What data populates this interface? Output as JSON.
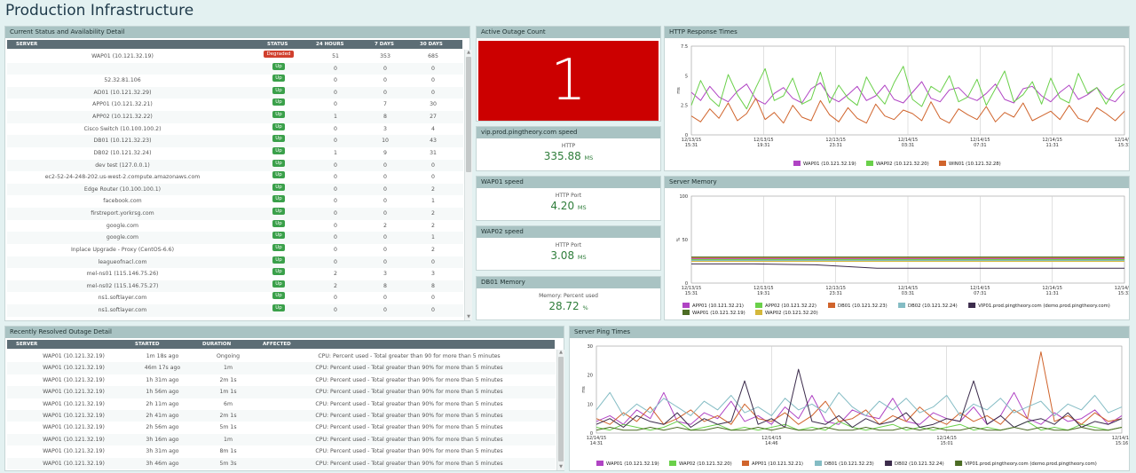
{
  "page_title": "Production Infrastructure",
  "colors": {
    "purple": "#b044c4",
    "green": "#6ad04a",
    "orange": "#d0642c",
    "teal": "#84bcc4",
    "dark": "#3c2c4c",
    "olive": "#4c6c24",
    "yellow": "#d4b83c",
    "red": "#cc0000",
    "up": "#3aa04a",
    "degraded": "#d0402e"
  },
  "status": {
    "header": "Current Status and Availability Detail",
    "columns": [
      "SERVER",
      "STATUS",
      "24 HOURS",
      "7 DAYS",
      "30 DAYS"
    ],
    "rows": [
      {
        "server": "WAP01 (10.121.32.19)",
        "status": "Degraded",
        "h24": "51",
        "d7": "353",
        "d30": "685"
      },
      {
        "server": "",
        "status": "Up",
        "h24": "0",
        "d7": "0",
        "d30": "0"
      },
      {
        "server": "52.32.81.106",
        "status": "Up",
        "h24": "0",
        "d7": "0",
        "d30": "0"
      },
      {
        "server": "AD01 (10.121.32.29)",
        "status": "Up",
        "h24": "0",
        "d7": "0",
        "d30": "0"
      },
      {
        "server": "APP01 (10.121.32.21)",
        "status": "Up",
        "h24": "0",
        "d7": "7",
        "d30": "30"
      },
      {
        "server": "APP02 (10.121.32.22)",
        "status": "Up",
        "h24": "1",
        "d7": "8",
        "d30": "27"
      },
      {
        "server": "Cisco Switch (10.100.100.2)",
        "status": "Up",
        "h24": "0",
        "d7": "3",
        "d30": "4"
      },
      {
        "server": "DB01 (10.121.32.23)",
        "status": "Up",
        "h24": "0",
        "d7": "10",
        "d30": "43"
      },
      {
        "server": "DB02 (10.121.32.24)",
        "status": "Up",
        "h24": "1",
        "d7": "9",
        "d30": "31"
      },
      {
        "server": "dev test (127.0.0.1)",
        "status": "Up",
        "h24": "0",
        "d7": "0",
        "d30": "0"
      },
      {
        "server": "ec2-52-24-248-202.us-west-2.compute.amazonaws.com",
        "status": "Up",
        "h24": "0",
        "d7": "0",
        "d30": "0"
      },
      {
        "server": "Edge Router (10.100.100.1)",
        "status": "Up",
        "h24": "0",
        "d7": "0",
        "d30": "2"
      },
      {
        "server": "facebook.com",
        "status": "Up",
        "h24": "0",
        "d7": "0",
        "d30": "1"
      },
      {
        "server": "firstreport.yorkrsg.com",
        "status": "Up",
        "h24": "0",
        "d7": "0",
        "d30": "2"
      },
      {
        "server": "google.com",
        "status": "Up",
        "h24": "0",
        "d7": "2",
        "d30": "2"
      },
      {
        "server": "google.com",
        "status": "Up",
        "h24": "0",
        "d7": "0",
        "d30": "1"
      },
      {
        "server": "Inplace Upgrade - Proxy (CentOS-6.6)",
        "status": "Up",
        "h24": "0",
        "d7": "0",
        "d30": "2"
      },
      {
        "server": "leagueofnacl.com",
        "status": "Up",
        "h24": "0",
        "d7": "0",
        "d30": "0"
      },
      {
        "server": "mel-ns01 (115.146.75.26)",
        "status": "Up",
        "h24": "2",
        "d7": "3",
        "d30": "3"
      },
      {
        "server": "mel-ns02 (115.146.75.27)",
        "status": "Up",
        "h24": "2",
        "d7": "8",
        "d30": "8"
      },
      {
        "server": "ns1.softlayer.com",
        "status": "Up",
        "h24": "0",
        "d7": "0",
        "d30": "0"
      },
      {
        "server": "ns1.softlayer.com",
        "status": "Up",
        "h24": "0",
        "d7": "0",
        "d30": "0"
      }
    ]
  },
  "resolved": {
    "header": "Recently Resolved Outage Detail",
    "columns": [
      "SERVER",
      "STARTED",
      "DURATION",
      "AFFECTED"
    ],
    "rows": [
      {
        "server": "WAP01 (10.121.32.19)",
        "started": "1m 18s ago",
        "duration": "Ongoing",
        "affected": "CPU: Percent used - Total greater than 90 for more than 5 minutes"
      },
      {
        "server": "WAP01 (10.121.32.19)",
        "started": "46m 17s ago",
        "duration": "1m",
        "affected": "CPU: Percent used - Total greater than 90% for more than 5 minutes"
      },
      {
        "server": "WAP01 (10.121.32.19)",
        "started": "1h 31m ago",
        "duration": "2m 1s",
        "affected": "CPU: Percent used - Total greater than 90% for more than 5 minutes"
      },
      {
        "server": "WAP01 (10.121.32.19)",
        "started": "1h 56m ago",
        "duration": "1m 1s",
        "affected": "CPU: Percent used - Total greater than 90% for more than 5 minutes"
      },
      {
        "server": "WAP01 (10.121.32.19)",
        "started": "2h 11m ago",
        "duration": "6m",
        "affected": "CPU: Percent used - Total greater than 90% for more than 5 minutes"
      },
      {
        "server": "WAP01 (10.121.32.19)",
        "started": "2h 41m ago",
        "duration": "2m 1s",
        "affected": "CPU: Percent used - Total greater than 90% for more than 5 minutes"
      },
      {
        "server": "WAP01 (10.121.32.19)",
        "started": "2h 56m ago",
        "duration": "5m 1s",
        "affected": "CPU: Percent used - Total greater than 90% for more than 5 minutes"
      },
      {
        "server": "WAP01 (10.121.32.19)",
        "started": "3h 16m ago",
        "duration": "1m",
        "affected": "CPU: Percent used - Total greater than 90% for more than 5 minutes"
      },
      {
        "server": "WAP01 (10.121.32.19)",
        "started": "3h 31m ago",
        "duration": "8m 1s",
        "affected": "CPU: Percent used - Total greater than 90% for more than 5 minutes"
      },
      {
        "server": "WAP01 (10.121.32.19)",
        "started": "3h 46m ago",
        "duration": "5m 3s",
        "affected": "CPU: Percent used - Total greater than 90% for more than 5 minutes"
      }
    ]
  },
  "outage": {
    "header": "Active Outage Count",
    "value": "1"
  },
  "metrics": [
    {
      "header": "vip.prod.pingtheory.com speed",
      "label": "HTTP",
      "value": "335.88",
      "unit": "MS"
    },
    {
      "header": "WAP01 speed",
      "label": "HTTP Port",
      "value": "4.20",
      "unit": "MS"
    },
    {
      "header": "WAP02 speed",
      "label": "HTTP Port",
      "value": "3.08",
      "unit": "MS"
    },
    {
      "header": "DB01 Memory",
      "label": "Memory: Percent used",
      "value": "28.72",
      "unit": "%"
    }
  ],
  "chart_data": [
    {
      "type": "line",
      "title": "HTTP Response Times",
      "ylabel": "ms",
      "ylim": [
        0,
        7.5
      ],
      "y_ticks": [
        "7.5",
        "5",
        "2.5",
        "0"
      ],
      "x_ticks": [
        "12/13/15\n15:31",
        "12/13/15\n19:31",
        "12/13/15\n23:31",
        "12/14/15\n03:31",
        "12/14/15\n07:31",
        "12/14/15\n11:31",
        "12/14/15\n15:31"
      ],
      "series": [
        {
          "name": "WAP01 (10.121.32.19)",
          "color": "#b044c4",
          "values": [
            3.6,
            2.9,
            4.1,
            3.2,
            2.8,
            3.7,
            4.3,
            3.0,
            2.6,
            3.5,
            4.0,
            3.1,
            2.7,
            3.9,
            4.4,
            3.2,
            2.8,
            3.4,
            4.1,
            2.9,
            3.3,
            4.2,
            3.0,
            2.7,
            3.6,
            4.5,
            3.1,
            2.8,
            3.8,
            4.0,
            3.2,
            2.9,
            3.5,
            4.3,
            3.0,
            2.7,
            3.9,
            4.1,
            3.3,
            2.8,
            3.6,
            4.2,
            3.0,
            3.4,
            4.0,
            3.1,
            2.8,
            3.7
          ]
        },
        {
          "name": "WAP02 (10.121.32.20)",
          "color": "#6ad04a",
          "values": [
            2.5,
            4.6,
            3.1,
            2.4,
            5.1,
            3.4,
            2.2,
            4.0,
            5.6,
            2.9,
            3.3,
            4.8,
            2.6,
            3.0,
            5.3,
            2.7,
            4.2,
            3.1,
            2.5,
            4.9,
            3.5,
            2.6,
            4.4,
            5.8,
            3.0,
            2.4,
            4.1,
            3.6,
            5.0,
            2.8,
            3.2,
            4.7,
            2.5,
            3.9,
            5.4,
            2.8,
            3.4,
            4.5,
            2.6,
            4.8,
            3.1,
            2.7,
            5.2,
            3.5,
            4.0,
            2.6,
            3.8,
            4.3
          ]
        },
        {
          "name": "WIN01 (10.121.32.28)",
          "color": "#d0642c",
          "values": [
            1.6,
            1.1,
            2.2,
            1.4,
            2.7,
            1.2,
            1.8,
            3.1,
            1.3,
            1.9,
            1.0,
            2.5,
            1.5,
            1.2,
            2.9,
            1.7,
            1.1,
            2.3,
            1.4,
            1.0,
            2.6,
            1.6,
            1.3,
            2.1,
            1.8,
            1.2,
            2.8,
            1.4,
            1.0,
            2.2,
            1.7,
            1.3,
            2.4,
            1.1,
            1.9,
            1.5,
            2.7,
            1.2,
            1.6,
            2.0,
            1.3,
            2.5,
            1.4,
            1.1,
            2.3,
            1.8,
            1.2,
            2.0
          ]
        }
      ]
    },
    {
      "type": "line",
      "title": "Server Memory",
      "ylabel": "%",
      "ylim": [
        0,
        100
      ],
      "y_ticks": [
        "100",
        "50",
        "0"
      ],
      "x_ticks": [
        "12/13/15\n15:31",
        "12/13/15\n19:31",
        "12/13/15\n23:31",
        "12/14/15\n03:31",
        "12/14/15\n07:31",
        "12/14/15\n11:31",
        "12/14/15\n15:31"
      ],
      "series": [
        {
          "name": "APP01 (10.121.32.21)",
          "color": "#b044c4",
          "values": [
            28,
            28,
            28,
            28,
            28,
            28,
            28,
            28
          ]
        },
        {
          "name": "APP02 (10.121.32.22)",
          "color": "#6ad04a",
          "values": [
            27,
            27,
            27,
            27,
            27,
            27,
            27,
            27
          ]
        },
        {
          "name": "DB01 (10.121.32.23)",
          "color": "#d0642c",
          "values": [
            29,
            29,
            29,
            29,
            29,
            29,
            29,
            29
          ]
        },
        {
          "name": "DB02 (10.121.32.24)",
          "color": "#84bcc4",
          "values": [
            26,
            26,
            26,
            26,
            26,
            26,
            26,
            26
          ]
        },
        {
          "name": "VIP01.prod.pingtheory.com (demo.prod.pingtheory.com)",
          "color": "#3c2c4c",
          "values": [
            22,
            22,
            21,
            17,
            17,
            17,
            17,
            17
          ]
        },
        {
          "name": "WAP01 (10.121.32.19)",
          "color": "#4c6c24",
          "values": [
            30,
            30,
            30,
            30,
            30,
            30,
            30,
            30
          ]
        },
        {
          "name": "WAP02 (10.121.32.20)",
          "color": "#d4b83c",
          "values": [
            25,
            25,
            25,
            25,
            25,
            25,
            25,
            25
          ]
        }
      ]
    },
    {
      "type": "line",
      "title": "Server Ping Times",
      "ylabel": "ms",
      "ylim": [
        0,
        30
      ],
      "y_ticks": [
        "30",
        "20",
        "10",
        "0"
      ],
      "x_ticks": [
        "12/14/15\n14:31",
        "12/14/15\n14:46",
        "12/14/15\n15:01",
        "12/14/15\n15:16"
      ],
      "series": [
        {
          "name": "WAP01 (10.121.32.19)",
          "color": "#b044c4",
          "values": [
            4,
            6,
            3,
            8,
            5,
            14,
            4,
            3,
            7,
            5,
            11,
            4,
            6,
            3,
            9,
            5,
            13,
            4,
            3,
            8,
            6,
            5,
            12,
            4,
            3,
            7,
            5,
            4,
            9,
            3,
            6,
            14,
            5,
            3,
            7,
            4,
            5,
            8,
            3,
            6
          ]
        },
        {
          "name": "WAP02 (10.121.32.20)",
          "color": "#6ad04a",
          "values": [
            2,
            1,
            3,
            2,
            1,
            2,
            4,
            1,
            2,
            3,
            1,
            2,
            1,
            2,
            3,
            1,
            2,
            1,
            4,
            2,
            1,
            2,
            3,
            1,
            2,
            1,
            2,
            3,
            1,
            2,
            1,
            2,
            4,
            1,
            2,
            1,
            3,
            2,
            1,
            2
          ]
        },
        {
          "name": "APP01 (10.121.32.21)",
          "color": "#d0642c",
          "values": [
            5,
            3,
            7,
            4,
            9,
            3,
            5,
            8,
            4,
            6,
            3,
            10,
            5,
            4,
            7,
            3,
            6,
            11,
            4,
            5,
            8,
            3,
            6,
            4,
            9,
            5,
            3,
            7,
            4,
            6,
            3,
            8,
            5,
            28,
            4,
            6,
            3,
            7,
            4,
            5
          ]
        },
        {
          "name": "DB01 (10.121.32.23)",
          "color": "#84bcc4",
          "values": [
            8,
            14,
            6,
            10,
            7,
            12,
            9,
            6,
            11,
            8,
            13,
            7,
            9,
            6,
            12,
            8,
            10,
            7,
            14,
            9,
            6,
            11,
            8,
            12,
            7,
            9,
            13,
            6,
            10,
            8,
            12,
            7,
            9,
            11,
            6,
            10,
            8,
            13,
            7,
            9
          ]
        },
        {
          "name": "DB02 (10.121.32.24)",
          "color": "#3c2c4c",
          "values": [
            3,
            5,
            2,
            6,
            4,
            3,
            7,
            2,
            5,
            3,
            4,
            18,
            3,
            5,
            2,
            22,
            4,
            3,
            6,
            2,
            5,
            3,
            4,
            7,
            2,
            3,
            5,
            4,
            18,
            3,
            6,
            2,
            4,
            5,
            3,
            7,
            2,
            4,
            3,
            5
          ]
        },
        {
          "name": "VIP01.prod.pingtheory.com (demo.prod.pingtheory.com)",
          "color": "#4c6c24",
          "values": [
            1,
            2,
            1,
            1,
            2,
            1,
            2,
            1,
            1,
            2,
            1,
            1,
            2,
            1,
            2,
            1,
            1,
            2,
            1,
            1,
            2,
            1,
            1,
            2,
            1,
            2,
            1,
            1,
            2,
            1,
            1,
            2,
            1,
            2,
            1,
            1,
            2,
            1,
            1,
            2
          ]
        }
      ]
    }
  ]
}
